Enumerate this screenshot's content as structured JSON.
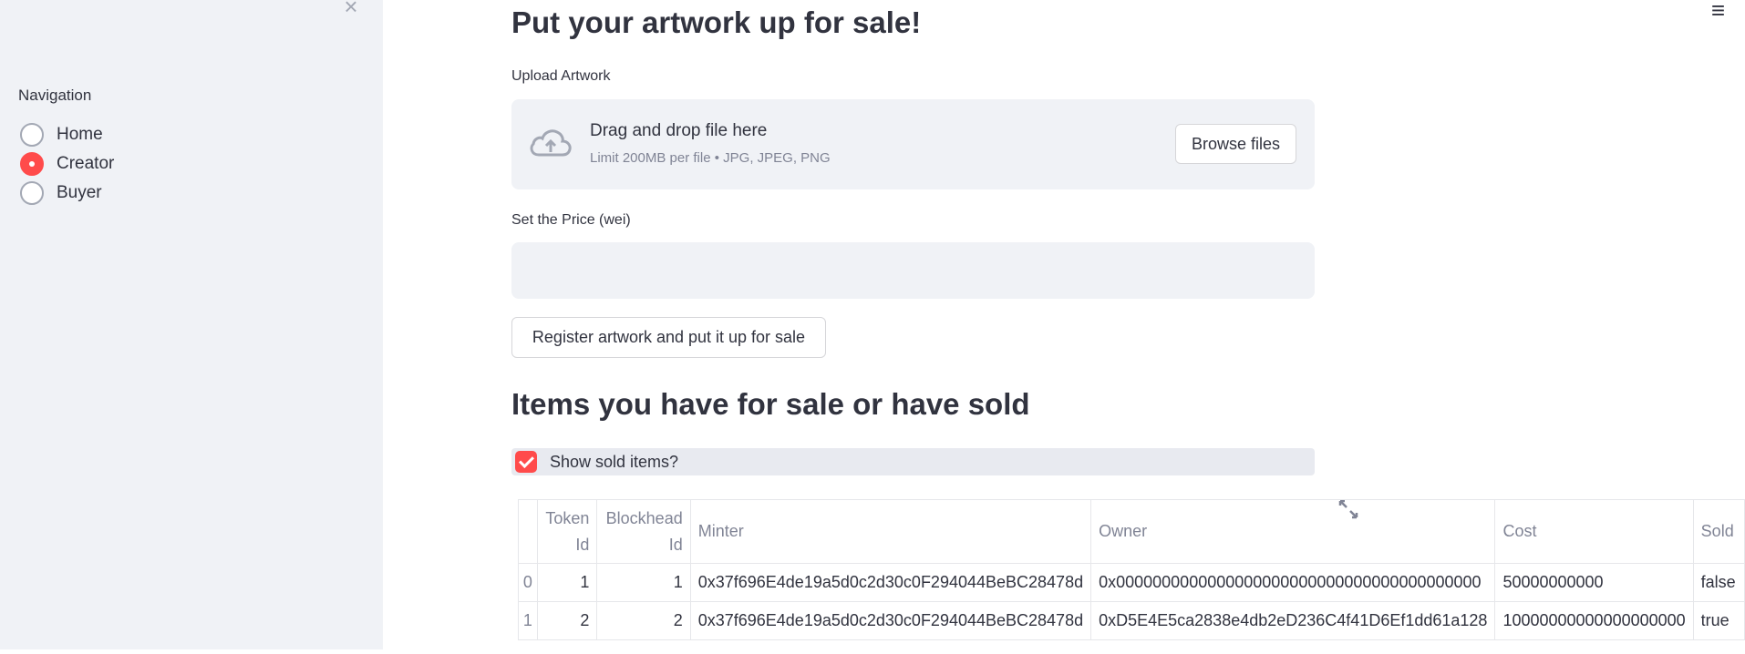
{
  "sidebar": {
    "close_icon": "close-icon",
    "navigation_label": "Navigation",
    "options": [
      {
        "label": "Home",
        "checked": false
      },
      {
        "label": "Creator",
        "checked": true
      },
      {
        "label": "Buyer",
        "checked": false
      }
    ],
    "accent": "#ff4b4b"
  },
  "main": {
    "menu_icon": "hamburger-icon",
    "title": "Put your artwork up for sale!",
    "upload_label": "Upload Artwork",
    "uploader": {
      "drag_text": "Drag and drop file here",
      "limit_text": "Limit 200MB per file • JPG, JPEG, PNG",
      "browse_label": "Browse files"
    },
    "price_label": "Set the Price (wei)",
    "price_value": "",
    "register_label": "Register artwork and put it up for sale",
    "items_title": "Items you have for sale or have sold",
    "show_sold_label": "Show sold items?",
    "show_sold_checked": true,
    "table": {
      "headers": {
        "token_1": "Token",
        "token_2": "Id",
        "blockhead_1": "Blockhead",
        "blockhead_2": "Id",
        "minter": "Minter",
        "owner": "Owner",
        "cost": "Cost",
        "sold": "Sold"
      },
      "rows": [
        {
          "index": "0",
          "token_id": "1",
          "blockhead_id": "1",
          "minter": "0x37f696E4de19a5d0c2d30c0F294044BeBC28478d",
          "owner": "0x0000000000000000000000000000000000000000",
          "cost": "50000000000",
          "sold": "false"
        },
        {
          "index": "1",
          "token_id": "2",
          "blockhead_id": "2",
          "minter": "0x37f696E4de19a5d0c2d30c0F294044BeBC28478d",
          "owner": "0xD5E4E5ca2838e4db2eD236C4f41D6Ef1dd61a128",
          "cost": "10000000000000000000",
          "sold": "true"
        }
      ]
    }
  }
}
